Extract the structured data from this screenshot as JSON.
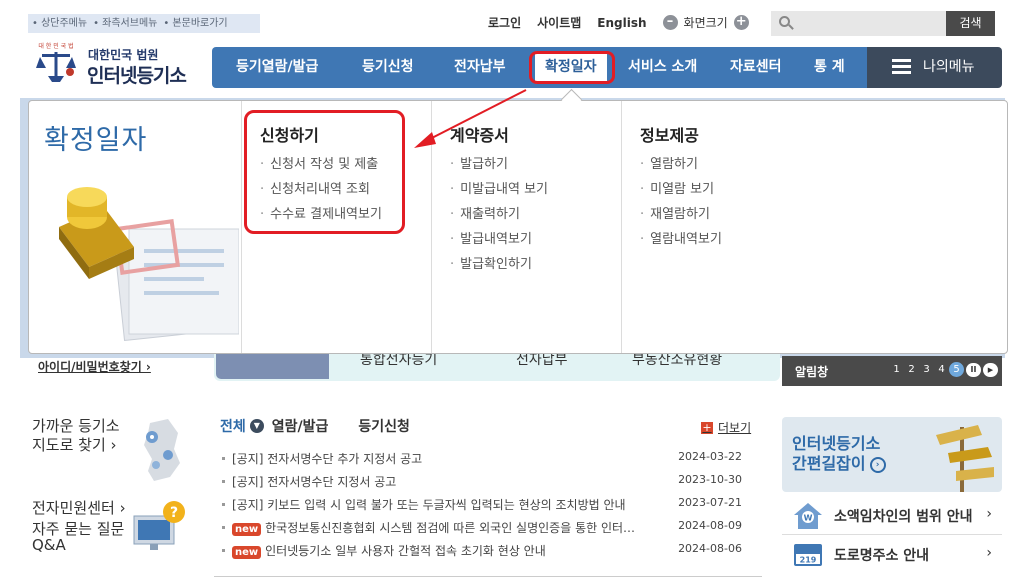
{
  "skip_links": [
    "• 상단주메뉴",
    "• 좌측서브메뉴",
    "• 본문바로가기"
  ],
  "util": {
    "login": "로그인",
    "sitemap": "사이트맵",
    "english": "English",
    "zoom_label": "화면크기",
    "zoom_out": "–",
    "zoom_in": "+"
  },
  "search": {
    "placeholder": "",
    "button": "검색"
  },
  "logo": {
    "line1": "대한민국 법원",
    "line2": "인터넷등기소",
    "seal_text": "대 한 민 국 법"
  },
  "gnb": {
    "items": [
      "등기열람/발급",
      "등기신청",
      "전자납부",
      "확정일자",
      "서비스 소개",
      "자료센터",
      "통 계"
    ],
    "active": "확정일자",
    "mymenu": "나의메뉴"
  },
  "mega": {
    "title": "확정일자",
    "columns": [
      {
        "heading": "신청하기",
        "items": [
          "신청서 작성 및 제출",
          "신청처리내역 조회",
          "수수료 결제내역보기"
        ]
      },
      {
        "heading": "계약증서",
        "items": [
          "발급하기",
          "미발급내역 보기",
          "재출력하기",
          "발급내역보기",
          "발급확인하기"
        ]
      },
      {
        "heading": "정보제공",
        "items": [
          "열람하기",
          "미열람 보기",
          "재열람하기",
          "열람내역보기"
        ]
      }
    ]
  },
  "background": {
    "id_find": "아이디/비밀번호찾기 ›",
    "quick": [
      "통합전자등기",
      "전자납부",
      "부동산소유현황"
    ],
    "alarm": {
      "label": "알림창",
      "pages": [
        "1",
        "2",
        "3",
        "4",
        "5"
      ],
      "current": "5",
      "pause": "II",
      "next": "▶"
    }
  },
  "left": {
    "near_line1": "가까운 등기소",
    "near_line2": "지도로 찾기 ›",
    "civil": "전자민원센터 ›",
    "faq_line1": "자주 묻는 질문",
    "faq_line2": "Q&A"
  },
  "notice": {
    "tabs": [
      "전체",
      "열람/발급",
      "등기신청"
    ],
    "more": "더보기",
    "items": [
      {
        "new": false,
        "text": "[공지] 전자서명수단 추가 지정서 공고",
        "date": "2024-03-22"
      },
      {
        "new": false,
        "text": "[공지] 전자서명수단 지정서 공고",
        "date": "2023-10-30"
      },
      {
        "new": false,
        "text": "[공지] 키보드 입력 시 입력 불가 또는 두글자씩 입력되는 현상의 조치방법 안내",
        "date": "2023-07-21"
      },
      {
        "new": true,
        "text": "한국정보통신진흥협회 시스템 점검에 따른 외국인 실명인증을 통한 인터…",
        "date": "2024-08-09"
      },
      {
        "new": true,
        "text": "인터넷등기소 일부 사용자 간헐적 접속 초기화 현상 안내",
        "date": "2024-08-06"
      }
    ],
    "new_label": "new"
  },
  "right": {
    "guide_line1": "인터넷등기소",
    "guide_line2": "간편길잡이",
    "guide_go": "›",
    "links": [
      "소액임차인의 범위 안내",
      "도로명주소 안내"
    ],
    "road_icon_text": "219"
  },
  "colors": {
    "brand_blue": "#3f77b4",
    "highlight_red": "#e21d24",
    "dark_menu": "#3c4a5c"
  }
}
